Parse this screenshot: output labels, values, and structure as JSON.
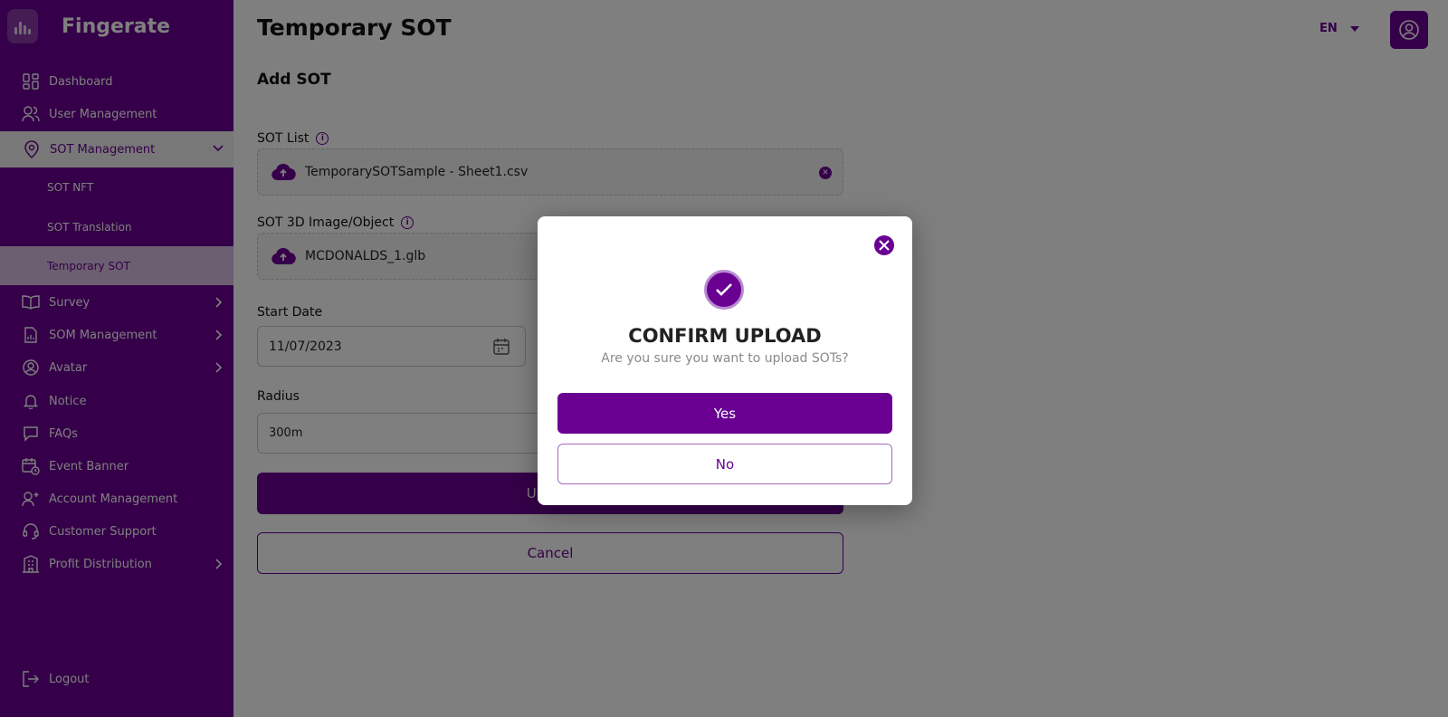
{
  "brand": {
    "name": "Fingerate"
  },
  "sidebar": {
    "items": [
      {
        "label": "Dashboard",
        "icon": "dashboard-icon"
      },
      {
        "label": "User Management",
        "icon": "users-icon"
      },
      {
        "label": "SOT Management",
        "icon": "location-pin-icon",
        "expanded": true
      },
      {
        "label": "Survey",
        "icon": "book-icon"
      },
      {
        "label": "SOM Management",
        "icon": "report-icon"
      },
      {
        "label": "Avatar",
        "icon": "avatar-icon"
      },
      {
        "label": "Notice",
        "icon": "bell-icon"
      },
      {
        "label": "FAQs",
        "icon": "chat-icon"
      },
      {
        "label": "Event Banner",
        "icon": "calendar-clock-icon"
      },
      {
        "label": "Account Management",
        "icon": "add-user-icon"
      },
      {
        "label": "Customer Support",
        "icon": "headset-icon"
      },
      {
        "label": "Profit Distribution",
        "icon": "building-icon"
      }
    ],
    "sub_items": [
      {
        "label": "SOT NFT"
      },
      {
        "label": "SOT Translation"
      },
      {
        "label": "Temporary SOT",
        "current": true
      }
    ],
    "logout": "Logout"
  },
  "header": {
    "title": "Temporary SOT",
    "language": "EN"
  },
  "form": {
    "section_title": "Add SOT",
    "sot_list_label": "SOT List",
    "sot_list_file": "TemporarySOTSample - Sheet1.csv",
    "object_label": "SOT 3D Image/Object",
    "object_file": "MCDONALDS_1.glb",
    "start_date_label": "Start Date",
    "start_date_value": "11/07/2023",
    "radius_label": "Radius",
    "radius_value": "300m",
    "upload_label": "Upload",
    "cancel_label": "Cancel"
  },
  "modal": {
    "title": "CONFIRM UPLOAD",
    "message": "Are you sure you want to upload SOTs?",
    "yes_label": "Yes",
    "no_label": "No"
  },
  "colors": {
    "primary": "#6a0092",
    "overlay": "rgba(0,0,0,0.5)"
  }
}
